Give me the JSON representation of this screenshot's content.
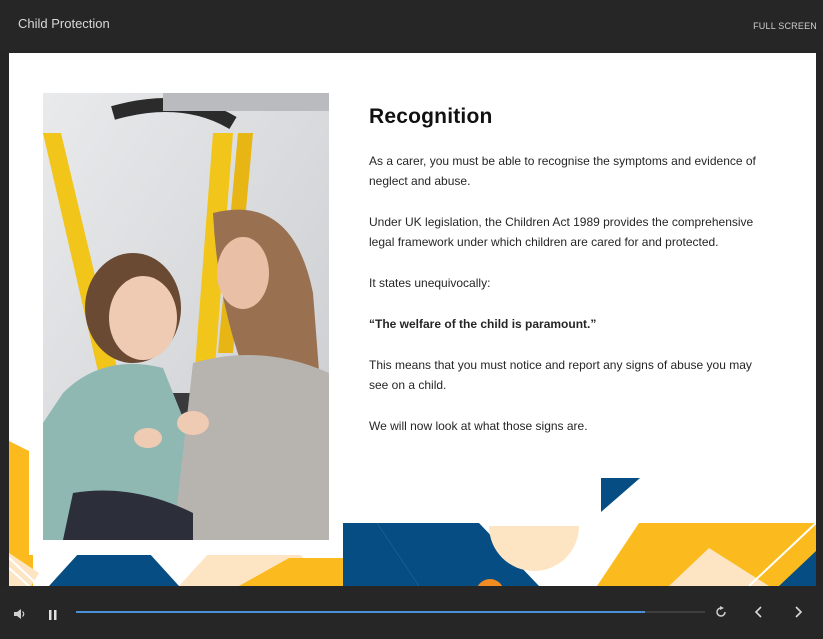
{
  "header": {
    "title": "Child Protection",
    "fullscreen_label": "FULL SCREEN"
  },
  "slide": {
    "heading": "Recognition",
    "paragraphs": [
      "As a carer, you must be able to recognise the symptoms and evidence of neglect and abuse.",
      "Under UK legislation, the Children Act 1989 provides the comprehensive legal framework under which children are cared for and protected.",
      "It states unequivocally:",
      "“The welfare of the child is paramount.”",
      "This means that you must notice and report any signs of abuse you may see on a child.",
      "We will now look at what those signs are."
    ]
  },
  "player": {
    "progress_fraction": 0.904
  },
  "colors": {
    "yellow": "#fbbb1e",
    "navy": "#054d82",
    "peach": "#fde5c4",
    "orange": "#f28b21",
    "progress": "#4a90d9"
  },
  "icons": {
    "volume": "volume-icon",
    "pause": "pause-icon",
    "replay": "replay-icon",
    "prev": "chevron-left-icon",
    "next": "chevron-right-icon"
  }
}
